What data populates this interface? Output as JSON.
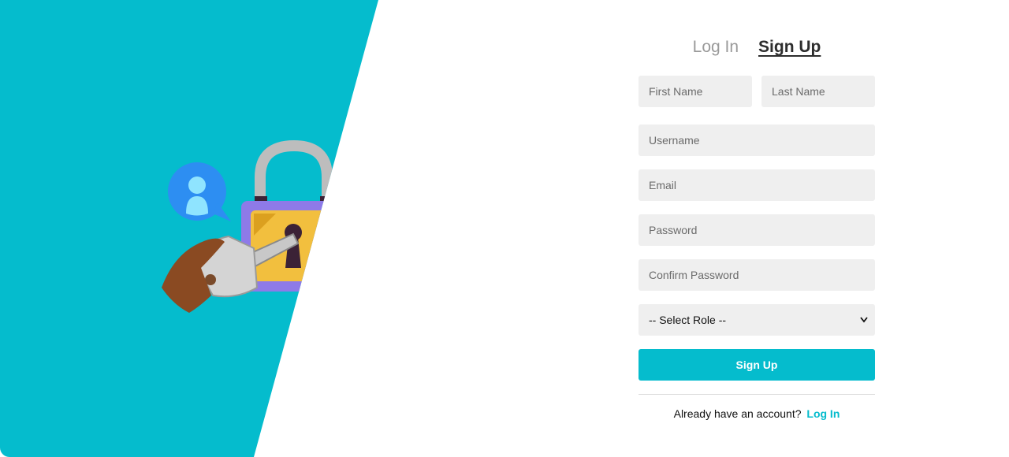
{
  "colors": {
    "accent": "#05bccd",
    "field_bg": "#efefef"
  },
  "tabs": {
    "login_label": "Log In",
    "signup_label": "Sign Up"
  },
  "form": {
    "first_name_placeholder": "First Name",
    "last_name_placeholder": "Last Name",
    "username_placeholder": "Username",
    "email_placeholder": "Email",
    "password_placeholder": "Password",
    "confirm_password_placeholder": "Confirm Password",
    "role_select_value": "-- Select Role --",
    "submit_label": "Sign Up"
  },
  "footer": {
    "prompt": "Already have an account?",
    "link_label": "Log In"
  },
  "illustration": {
    "icons": [
      "user-chat-icon",
      "padlock-icon",
      "hand-with-key-icon"
    ]
  }
}
